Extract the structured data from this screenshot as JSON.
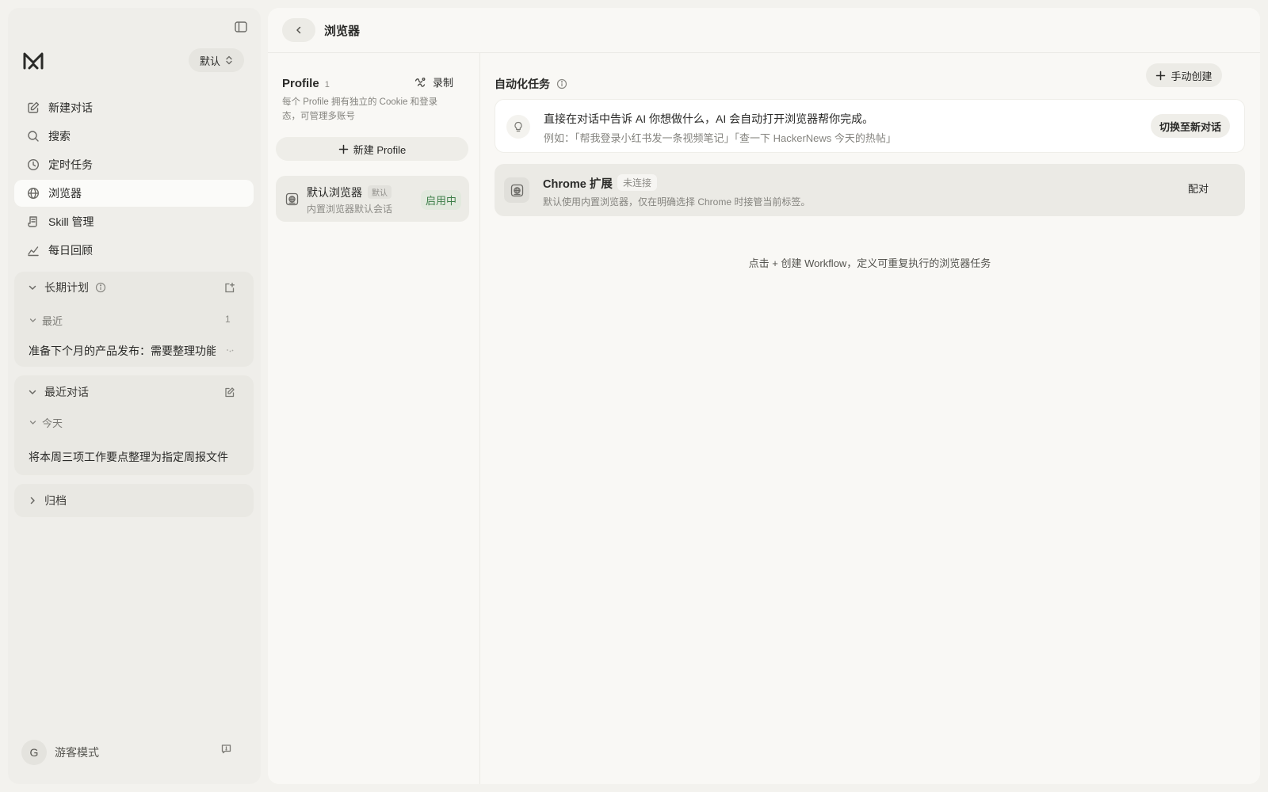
{
  "sidebar": {
    "workspace": "默认",
    "nav": [
      {
        "label": "新建对话",
        "icon": "edit-icon"
      },
      {
        "label": "搜索",
        "icon": "search-icon"
      },
      {
        "label": "定时任务",
        "icon": "clock-icon"
      },
      {
        "label": "浏览器",
        "icon": "globe-icon",
        "active": true
      },
      {
        "label": "Skill 管理",
        "icon": "scroll-icon"
      },
      {
        "label": "每日回顾",
        "icon": "chart-icon"
      }
    ],
    "long_term": {
      "title": "长期计划",
      "group": "最近",
      "count": "1",
      "item": "准备下个月的产品发布：需要整理功能"
    },
    "recent": {
      "title": "最近对话",
      "group": "今天",
      "item": "将本周三项工作要点整理为指定周报文件"
    },
    "archive": {
      "title": "归档"
    },
    "user": {
      "initial": "G",
      "name": "游客模式"
    }
  },
  "main": {
    "title": "浏览器",
    "profile": {
      "title": "Profile",
      "count": "1",
      "record_label": "录制",
      "description": "每个 Profile 拥有独立的 Cookie 和登录态，可管理多账号",
      "new_button": "新建 Profile",
      "card": {
        "name": "默认浏览器",
        "tag": "默认",
        "description": "内置浏览器默认会话",
        "status": "启用中"
      }
    },
    "automation": {
      "title": "自动化任务",
      "manual_button": "手动创建",
      "hint": {
        "line1": "直接在对话中告诉 AI 你想做什么，AI 会自动打开浏览器帮你完成。",
        "line2": "例如：「帮我登录小红书发一条视频笔记」「查一下 HackerNews 今天的热帖」",
        "button": "切换至新对话"
      },
      "extension": {
        "name": "Chrome 扩展",
        "status": "未连接",
        "description": "默认使用内置浏览器，仅在明确选择 Chrome 时接管当前标签。",
        "action": "配对"
      },
      "empty_hint": "点击 + 创建 Workflow，定义可重复执行的浏览器任务"
    }
  }
}
